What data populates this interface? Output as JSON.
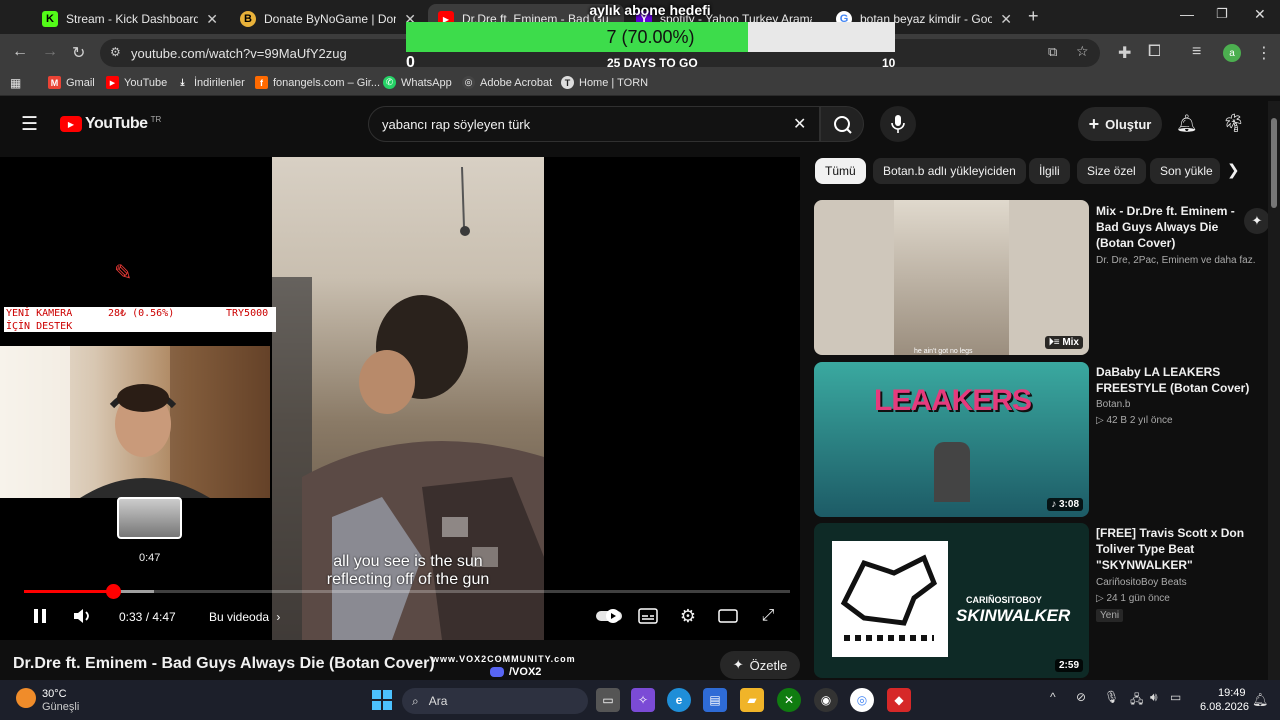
{
  "tabs": [
    {
      "label": "Stream - Kick Dashboard",
      "icon": "kick-icon",
      "color": "#53fc18"
    },
    {
      "label": "Donate ByNoGame | Donations",
      "icon": "bynogame-icon",
      "color": "#e9b23a"
    },
    {
      "label": "Dr.Dre ft. Eminem - Bad Gu",
      "icon": "youtube-icon",
      "color": "#ff0000"
    },
    {
      "label": "spotify - Yahoo Turkey Arama S",
      "icon": "yahoo-icon",
      "color": "#6001d2"
    },
    {
      "label": "botan beyaz kimdir - Google'da",
      "icon": "google-icon",
      "color": "#4285f4"
    }
  ],
  "address": {
    "url": "youtube.com/watch?v=99MaUfY2zug"
  },
  "bookmarks": [
    {
      "label": "Gmail",
      "icon": "gmail-icon",
      "color": "#ea4335"
    },
    {
      "label": "YouTube",
      "icon": "youtube-icon",
      "color": "#ff0000"
    },
    {
      "label": "İndirilenler",
      "icon": "download-icon",
      "color": "#5f6368"
    },
    {
      "label": "fonangels.com – Gir...",
      "icon": "fonangels-icon",
      "color": "#ff6a00"
    },
    {
      "label": "WhatsApp",
      "icon": "whatsapp-icon",
      "color": "#25d366"
    },
    {
      "label": "Adobe Acrobat",
      "icon": "acrobat-icon",
      "color": "#444"
    },
    {
      "label": "Home | TORN",
      "icon": "torn-icon",
      "color": "#555"
    }
  ],
  "goal": {
    "title": "aylık abone hedefi",
    "count_label": "7 (70.00%)",
    "progress": 0.7,
    "min": "0",
    "max": "10",
    "days_left": "25 DAYS TO GO"
  },
  "youtube": {
    "logo": "YouTube",
    "region": "TR",
    "search_query": "yabancı rap söyleyen türk",
    "create_label": "Oluştur"
  },
  "chips": [
    "Tümü",
    "Botan.b adlı yükleyiciden",
    "İlgili",
    "Size özel",
    "Son yükle"
  ],
  "overlay": {
    "donation_title_line1": "YENİ KAMERA",
    "donation_title_line2": "İÇİN DESTEK",
    "donation_progress": "28₺ (0.56%)",
    "donation_goal": "TRY5000"
  },
  "player": {
    "caption_line1": "all you see is the sun",
    "caption_line2": "reflecting off of the gun",
    "preview_time": "0:47",
    "time_display": "0:33 / 4:47",
    "played_fraction": 0.116,
    "buffered_fraction": 0.17,
    "chapter_label": "Bu videoda",
    "title": "Dr.Dre ft. Eminem - Bad Guys Always Die (Botan Cover)",
    "summarize_label": "Özetle"
  },
  "watermark": {
    "line1": "www.VOX2COMMUNITY.com",
    "line2": "/VOX2"
  },
  "recommendations": [
    {
      "title": "Mix - Dr.Dre ft. Eminem - Bad Guys Always Die (Botan Cover)",
      "meta1": "Dr. Dre, 2Pac, Eminem ve daha faz...",
      "meta2": "",
      "badge": "Mix",
      "thumb_caption": "he ain't got no legs"
    },
    {
      "title": "DaBaby LA LEAKERS FREESTYLE (Botan Cover)",
      "meta1": "Botan.b",
      "meta2": "▷ 42 B   2 yıl önce",
      "badge": "3:08",
      "thumb_caption": "LEAAKERS"
    },
    {
      "title": "[FREE] Travis Scott x Don Toliver Type Beat \"SKYNWALKER\"",
      "meta1": "CariñositoBoy Beats",
      "meta2": "▷ 24   1 gün önce",
      "badge": "2:59",
      "tag": "Yeni",
      "thumb_caption": "SKINWALKER",
      "thumb_sub": "CARIÑOSITOBOY"
    }
  ],
  "taskbar": {
    "weather_temp": "30°C",
    "weather_desc": "Güneşli",
    "search_label": "Ara",
    "time": "19:49",
    "date": "6.08.2026"
  }
}
